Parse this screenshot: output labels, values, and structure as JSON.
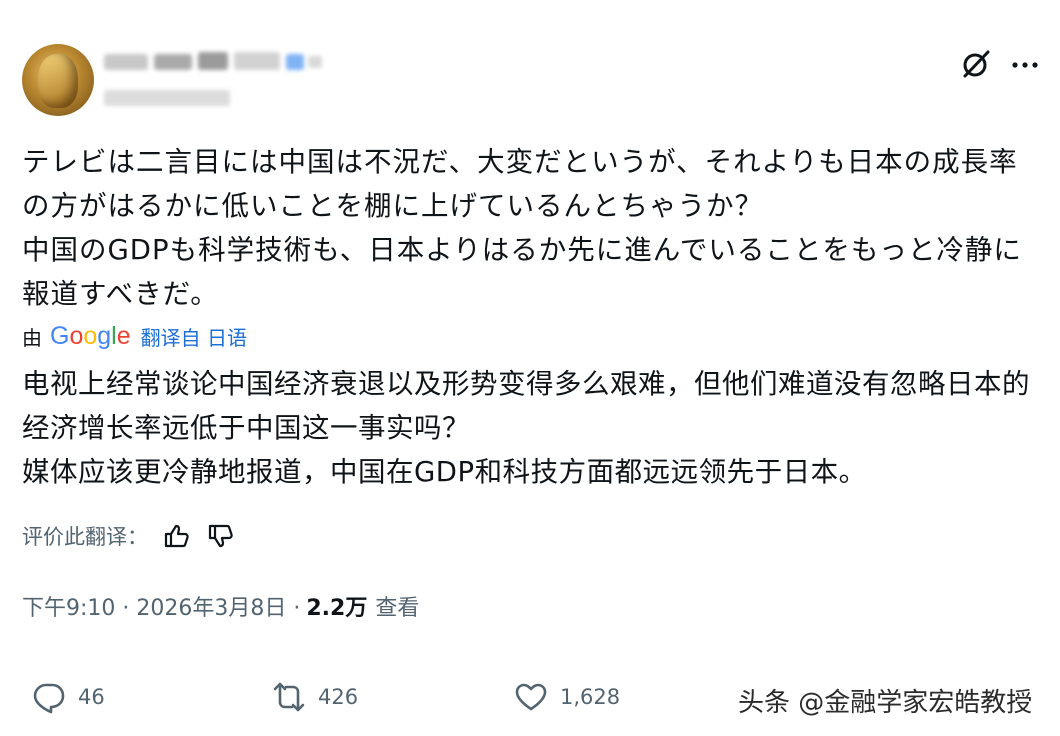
{
  "post": {
    "original_text": "テレビは二言目には中国は不況だ、大変だというが、それよりも日本の成長率の方がはるかに低いことを棚に上げているんとちゃうか？\n中国のGDPも科学技術も、日本よりはるか先に進んでいることをもっと冷静に報道すべきだ。",
    "translated_by_prefix": "由",
    "translation_engine": "Google",
    "translated_from": "翻译自 日语",
    "translated_text": "电视上经常谈论中国经济衰退以及形势变得多么艰难，但他们难道没有忽略日本的经济增长率远低于中国这一事实吗？\n媒体应该更冷静地报道，中国在GDP和科技方面都远远领先于日本。",
    "rate_label": "评价此翻译：",
    "timestamp": "下午9:10 · 2026年3月8日 · ",
    "views_count": "2.2万",
    "views_label": "查看"
  },
  "actions": {
    "replies": "46",
    "reposts": "426",
    "likes": "1,628"
  },
  "icons": {
    "header": [
      "grok-icon",
      "more-icon"
    ],
    "rating": [
      "thumbs-up-icon",
      "thumbs-down-icon"
    ],
    "actions": [
      "reply-icon",
      "repost-icon",
      "like-icon"
    ]
  },
  "watermark": "头条 @金融学家宏皓教授",
  "colors": {
    "link": "#1d6fd6",
    "secondary_text": "#536471",
    "primary_text": "#0f1419"
  }
}
